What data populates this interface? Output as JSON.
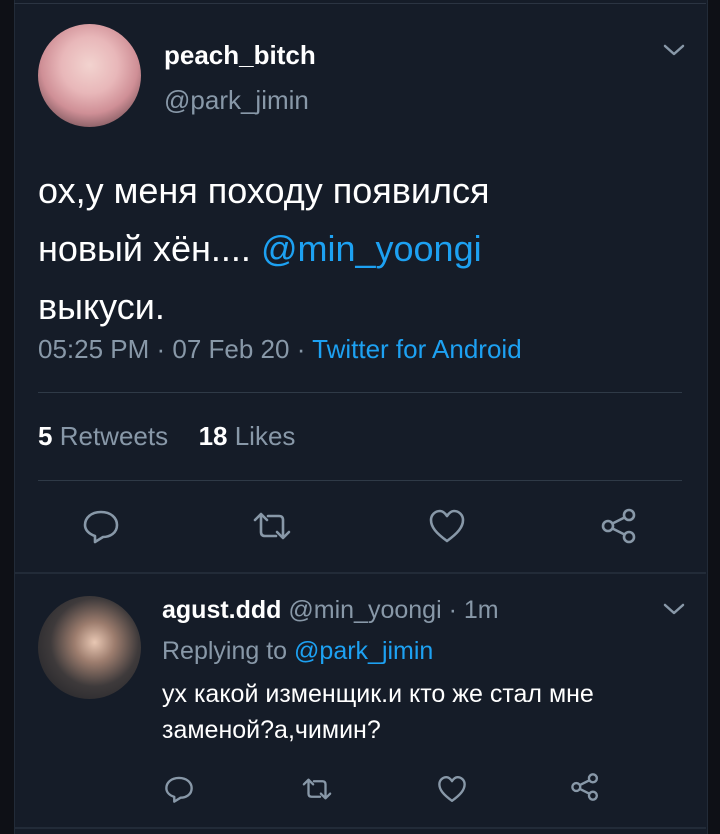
{
  "tweet": {
    "display_name": "peach_bitch",
    "handle": "@park_jimin",
    "text_line1": "ох,у меня походу появился",
    "text_line2_prefix": "новый хён.... ",
    "mention": "@min_yoongi",
    "text_line3": "выкуси.",
    "timestamp": "05:25 PM · 07 Feb 20 · ",
    "source": "Twitter for Android",
    "retweets_count": "5",
    "retweets_label": "Retweets",
    "likes_count": "18",
    "likes_label": "Likes"
  },
  "reply": {
    "display_name": "agust.ddd",
    "handle": "@min_yoongi",
    "time": "· 1m",
    "replying_to_label": "Replying to ",
    "replying_to_handle": "@park_jimin",
    "text_line1": "ух какой изменщик.и кто же стал мне",
    "text_line2": "заменой?а,чимин?"
  },
  "colors": {
    "background": "#151c28",
    "accent": "#1da1f2",
    "muted": "#8898a8"
  },
  "icons": [
    "chevron-down-icon",
    "reply-icon",
    "retweet-icon",
    "like-icon",
    "share-icon"
  ]
}
